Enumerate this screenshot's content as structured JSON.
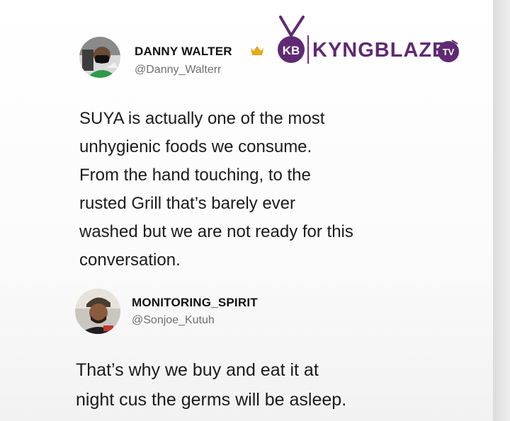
{
  "watermark": {
    "logo_badge_text": "KB",
    "logo_name": "KYNGBLAZE",
    "logo_tv_text": "TV",
    "brand_color": "#5f2a73"
  },
  "tweet": {
    "author_name": "DANNY WALTER",
    "author_handle": "@Danny_Walterr",
    "badge_icon": "crown-icon",
    "lines": [
      "SUYA is actually one of the most",
      "unhygienic foods we consume.",
      "From the hand touching, to the",
      "rusted Grill that’s barely ever",
      "washed but we are not ready for this",
      "conversation."
    ]
  },
  "reply": {
    "author_name": "MONITORING_SPIRIT",
    "author_handle": "@Sonjoe_Kutuh",
    "lines": [
      "That’s why we buy and eat it at",
      "night cus the germs will be asleep."
    ]
  }
}
